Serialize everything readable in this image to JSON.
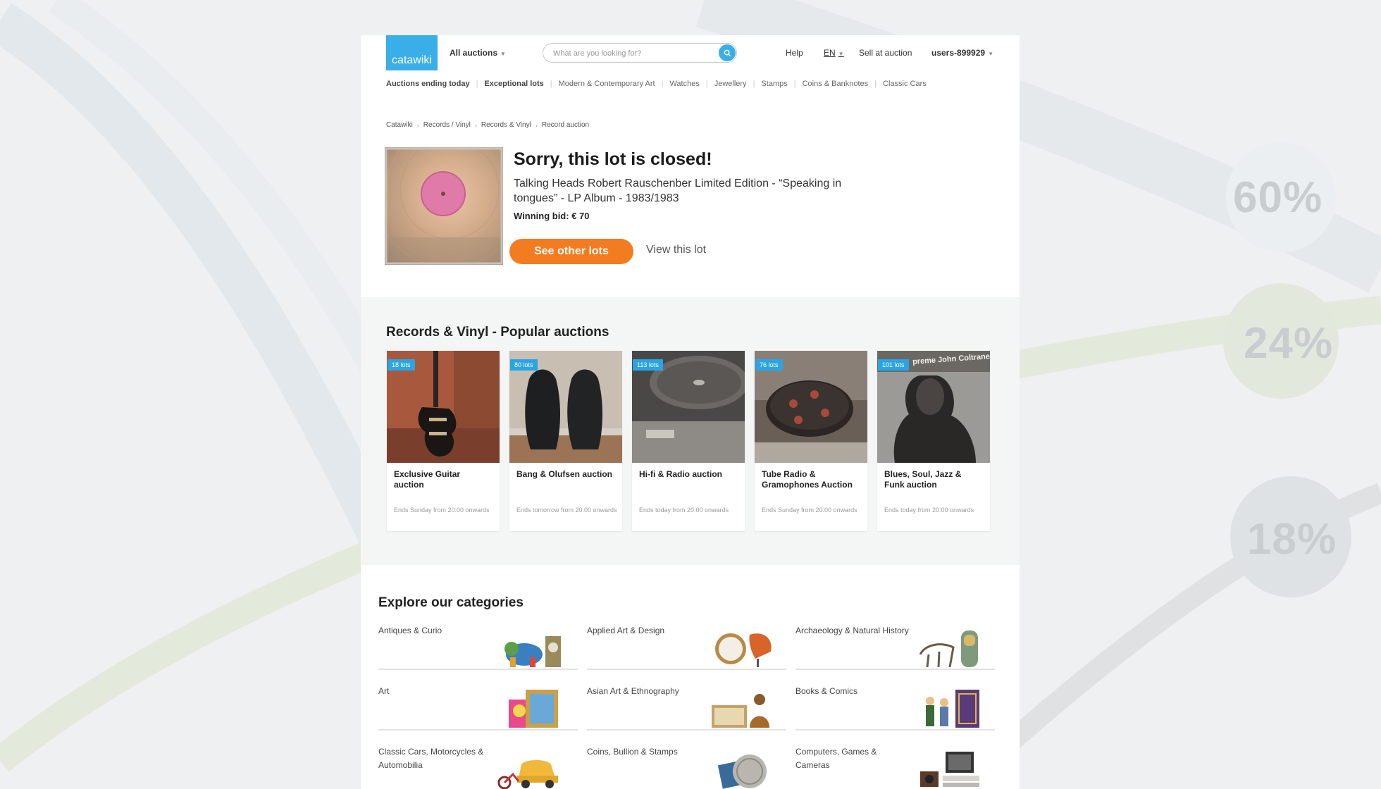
{
  "header": {
    "logo_text": "catawiki",
    "all_auctions_label": "All auctions",
    "search_placeholder": "What are you looking for?",
    "help_label": "Help",
    "language_label": "EN",
    "sell_label": "Sell at auction",
    "user_label": "users-899929"
  },
  "category_nav": [
    {
      "label": "Auctions ending today"
    },
    {
      "label": "Exceptional lots"
    },
    {
      "label": "Modern & Contemporary Art"
    },
    {
      "label": "Watches"
    },
    {
      "label": "Jewellery"
    },
    {
      "label": "Stamps"
    },
    {
      "label": "Coins & Banknotes"
    },
    {
      "label": "Classic Cars"
    }
  ],
  "breadcrumb": [
    {
      "label": "Catawiki"
    },
    {
      "label": "Records / Vinyl"
    },
    {
      "label": "Records & Vinyl"
    },
    {
      "label": "Record auction"
    }
  ],
  "lot": {
    "title": "Sorry, this lot is closed!",
    "description": "Talking Heads Robert Rauschenber Limited Edition - “Speaking in tongues” - LP Album - 1983/1983",
    "winning_bid": "Winning bid: € 70",
    "see_other_label": "See other lots",
    "view_lot_label": "View this lot"
  },
  "popular": {
    "title": "Records & Vinyl - Popular auctions",
    "cards": [
      {
        "badge": "18 lots",
        "title": "Exclusive Guitar auction",
        "ends": "Ends Sunday from 20:00 onwards",
        "image": "guitar-image"
      },
      {
        "badge": "80 lots",
        "title": "Bang & Olufsen auction",
        "ends": "Ends tomorrow from 20:00 onwards",
        "image": "speakers-image"
      },
      {
        "badge": "113 lots",
        "title": "Hi-fi & Radio auction",
        "ends": "Ends today from 20:00 onwards",
        "image": "turntable-image"
      },
      {
        "badge": "76 lots",
        "title": "Tube Radio & Gramophones Auction",
        "ends": "Ends Sunday from 20:00 onwards",
        "image": "record-player-image"
      },
      {
        "badge": "101 lots",
        "title": "Blues, Soul, Jazz & Funk auction",
        "ends": "Ends today from 20:00 onwards",
        "image": "album-cover-image",
        "cover_text": "preme John Coltrane"
      }
    ]
  },
  "categories": {
    "title": "Explore our categories",
    "items": [
      {
        "label": "Antiques & Curio"
      },
      {
        "label": "Applied Art & Design"
      },
      {
        "label": "Archaeology & Natural History"
      },
      {
        "label": "Art"
      },
      {
        "label": "Asian Art & Ethnography"
      },
      {
        "label": "Books & Comics"
      },
      {
        "label": "Classic Cars, Motorcycles & Automobilia"
      },
      {
        "label": "Coins, Bullion & Stamps"
      },
      {
        "label": "Computers, Games & Cameras"
      }
    ]
  },
  "background": {
    "percentages": [
      "60%",
      "24%",
      "18%"
    ]
  },
  "colors": {
    "brand_blue": "#3aaee8",
    "cta_orange": "#f47c20",
    "badge_blue": "#2aa5e3"
  }
}
